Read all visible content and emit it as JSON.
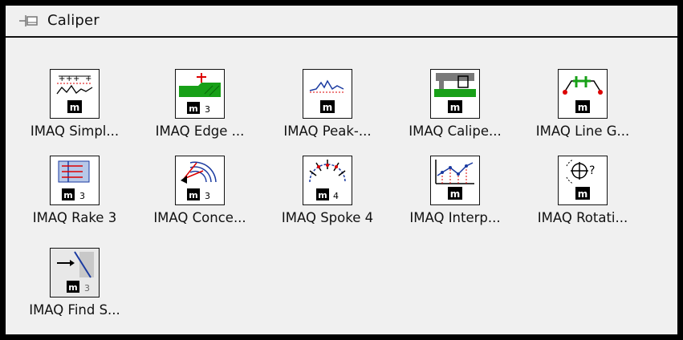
{
  "palette": {
    "title": "Caliper",
    "items": [
      {
        "label": "IMAQ Simpl...",
        "icon": "simple-edge-icon"
      },
      {
        "label": "IMAQ Edge ...",
        "icon": "edge-tool-icon"
      },
      {
        "label": "IMAQ Peak-...",
        "icon": "peak-valley-icon"
      },
      {
        "label": "IMAQ Calipe...",
        "icon": "caliper-tool-icon"
      },
      {
        "label": "IMAQ Line G...",
        "icon": "line-gauge-icon"
      },
      {
        "label": "IMAQ Rake 3",
        "icon": "rake-icon"
      },
      {
        "label": "IMAQ Conce...",
        "icon": "concentric-rake-icon"
      },
      {
        "label": "IMAQ Spoke 4",
        "icon": "spoke-icon"
      },
      {
        "label": "IMAQ Interp...",
        "icon": "interpolate-icon"
      },
      {
        "label": "IMAQ Rotati...",
        "icon": "rotation-detect-icon"
      },
      {
        "label": "IMAQ Find S...",
        "icon": "find-straight-edge-icon"
      }
    ]
  }
}
